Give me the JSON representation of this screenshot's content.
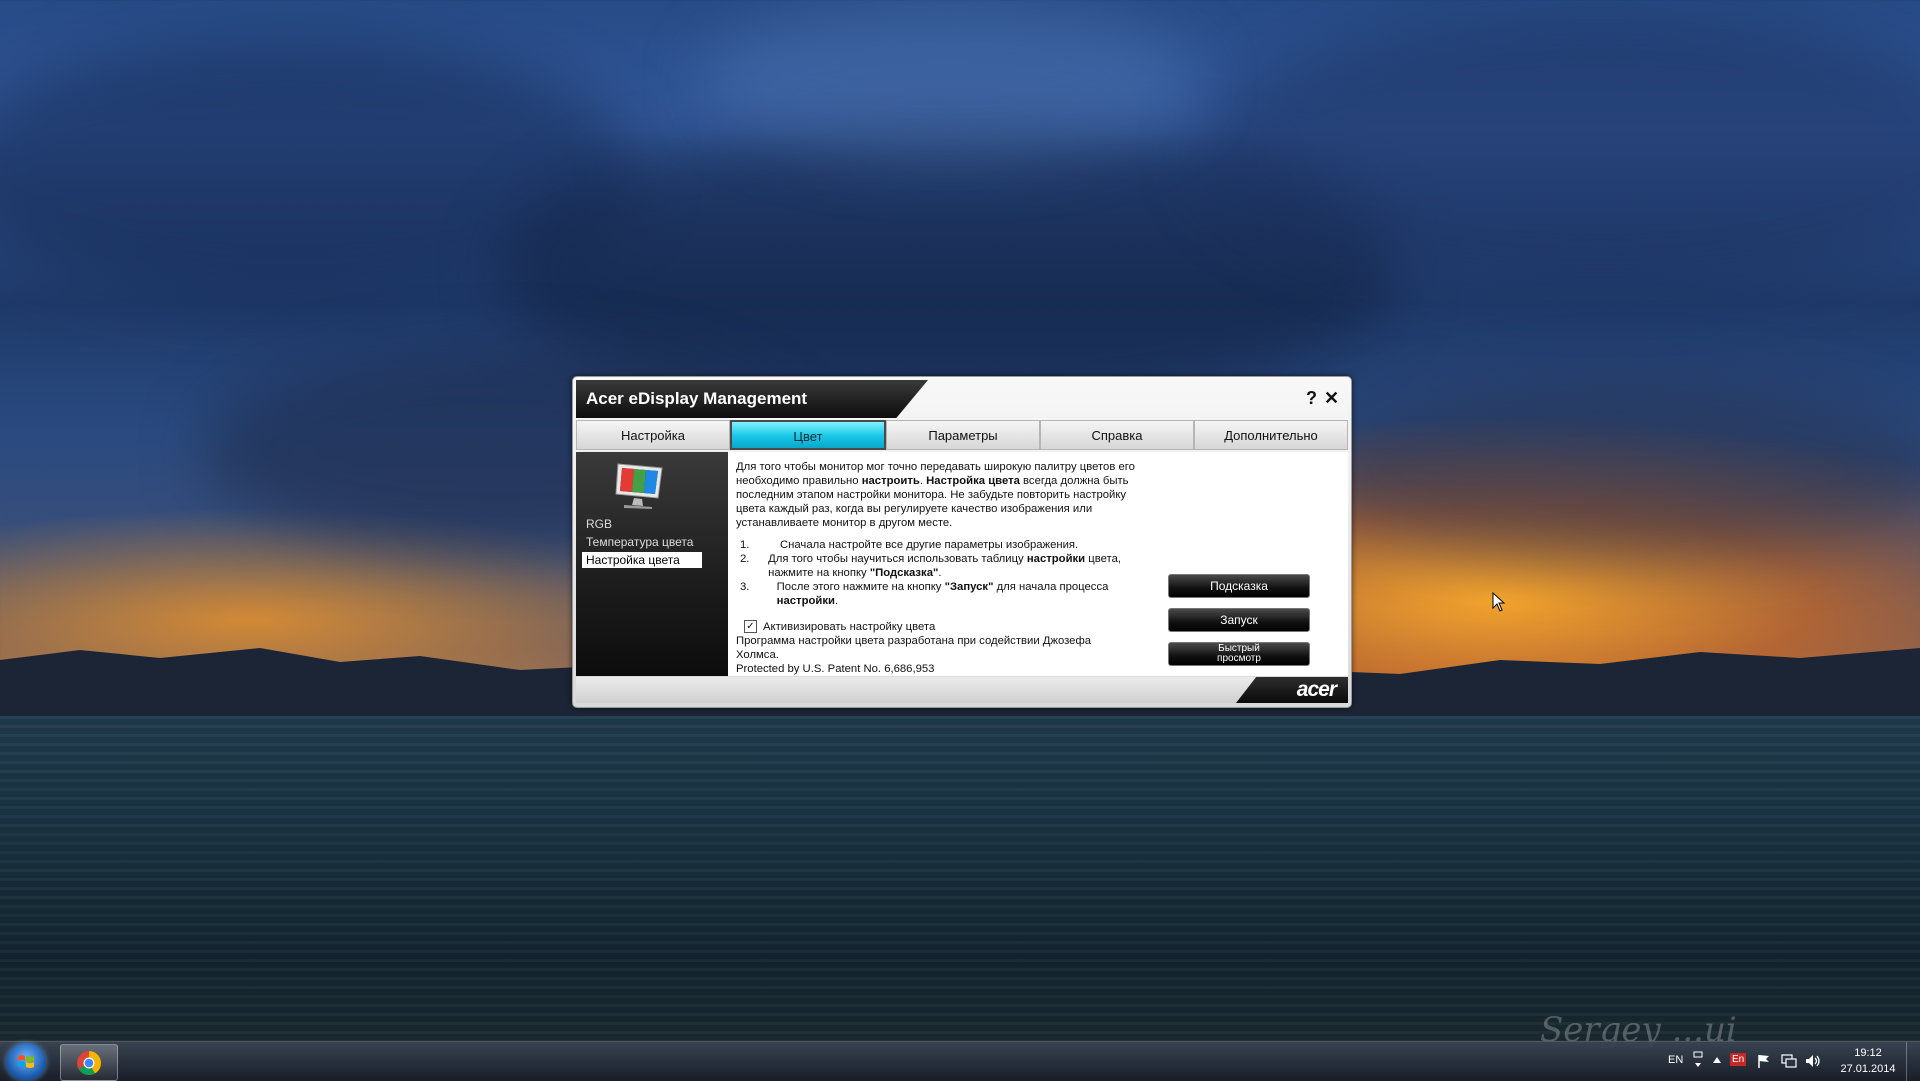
{
  "window": {
    "title": "Acer eDisplay Management",
    "help_label": "?",
    "close_label": "✕"
  },
  "tabs": [
    {
      "label": "Настройка"
    },
    {
      "label": "Цвет",
      "active": true
    },
    {
      "label": "Параметры"
    },
    {
      "label": "Справка"
    },
    {
      "label": "Дополнительно"
    }
  ],
  "sidebar": {
    "icon": "monitor-icon",
    "items": [
      {
        "label": "RGB"
      },
      {
        "label": "Температура цвета"
      },
      {
        "label": "Настройка цвета",
        "active": true
      }
    ]
  },
  "main": {
    "intro_1": "Для того чтобы монитор мог точно передавать широкую палитру цветов его необходимо правильно ",
    "intro_bold_1": "настроить",
    "intro_2": ". ",
    "intro_bold_2": "Настройка цвета",
    "intro_3": " всегда должна быть последним этапом настройки монитора. Не забудьте повторить настройку цвета каждый раз, когда вы регулируете качество изображения или устанавливаете монитор в другом месте.",
    "steps": [
      {
        "num": "1.",
        "text": "Сначала настройте все другие параметры изображения."
      },
      {
        "num": "2.",
        "text_a": "Для того чтобы научиться использовать таблицу ",
        "bold_a": "настройки",
        "text_b": " цвета, нажмите на кнопку ",
        "bold_b": "\"Подсказка\"",
        "text_c": "."
      },
      {
        "num": "3.",
        "text_a": "После этого нажмите на кнопку ",
        "bold_a": "\"Запуск\"",
        "text_b": " для начала процесса ",
        "bold_b": "настройки",
        "text_c": "."
      }
    ],
    "checkbox_label": "Активизировать настройку цвета",
    "checkbox_checked": true,
    "credit": "Программа настройки цвета разработана при содействии Джозефа Холмса.",
    "patent": "Protected by U.S. Patent No. 6,686,953"
  },
  "buttons": {
    "hint": "Подсказка",
    "start": "Запуск",
    "preview_line1": "Быстрый",
    "preview_line2": "просмотр"
  },
  "footer": {
    "brand": "acer"
  },
  "taskbar": {
    "lang": "EN",
    "keyboard": "En",
    "time": "19:12",
    "date": "27.01.2014"
  },
  "desktop": {
    "signature": "Sergey ...ui"
  }
}
